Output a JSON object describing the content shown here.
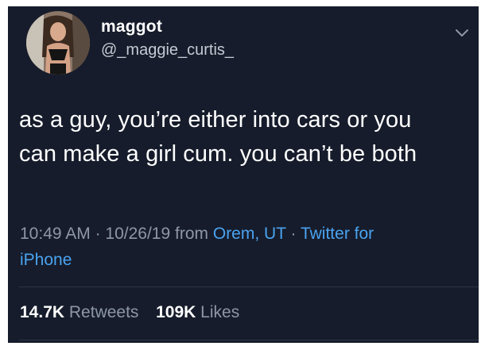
{
  "user": {
    "display_name": "maggot",
    "handle": "@_maggie_curtis_"
  },
  "tweet": {
    "line1": "as a guy, you’re either into cars or you",
    "line2": "can make a girl cum. you can’t be both"
  },
  "meta": {
    "time": "10:49 AM",
    "date": "10/26/19",
    "from_word": "from",
    "location": "Orem, UT",
    "source_line1": "Twitter for",
    "source_line2": "iPhone",
    "separator": "·"
  },
  "stats": {
    "retweets_count": "14.7K",
    "retweets_label": "Retweets",
    "likes_count": "109K",
    "likes_label": "Likes"
  },
  "icons": {
    "caret": "chevron-down-icon"
  },
  "colors": {
    "background": "#161c2b",
    "link": "#4aa3f0",
    "muted": "#8e97a6"
  }
}
